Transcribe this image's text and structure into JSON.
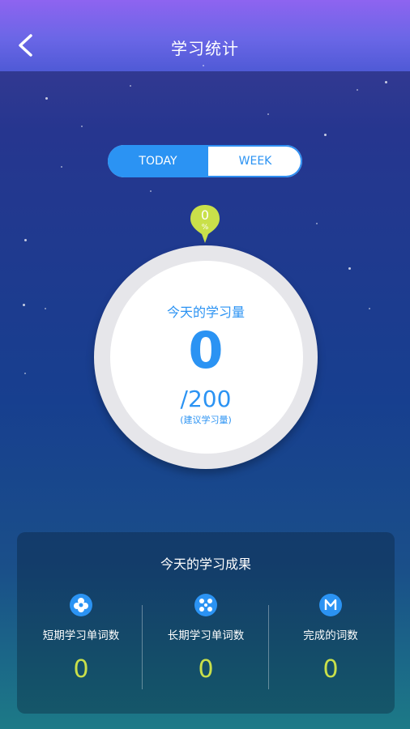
{
  "header": {
    "title": "学习统计",
    "back_icon": "chevron-left-icon"
  },
  "tabs": [
    {
      "label": "TODAY",
      "selected": true
    },
    {
      "label": "WEEK",
      "selected": false
    }
  ],
  "progress_pin": {
    "value": "0",
    "unit": "%"
  },
  "progress_circle": {
    "label": "今天的学习量",
    "count": "0",
    "target": "/200",
    "target_note": "(建议学习量)",
    "progress_fraction": 0
  },
  "results": {
    "title": "今天的学习成果",
    "items": [
      {
        "icon": "flower-icon",
        "label": "短期学习单词数",
        "value": "0"
      },
      {
        "icon": "flowers-icon",
        "label": "长期学习单词数",
        "value": "0"
      },
      {
        "icon": "m-badge-icon",
        "label": "完成的词数",
        "value": "0"
      }
    ]
  },
  "colors": {
    "accent": "#2b93f3",
    "pin": "#c9e04a",
    "value": "#c9e04a"
  }
}
